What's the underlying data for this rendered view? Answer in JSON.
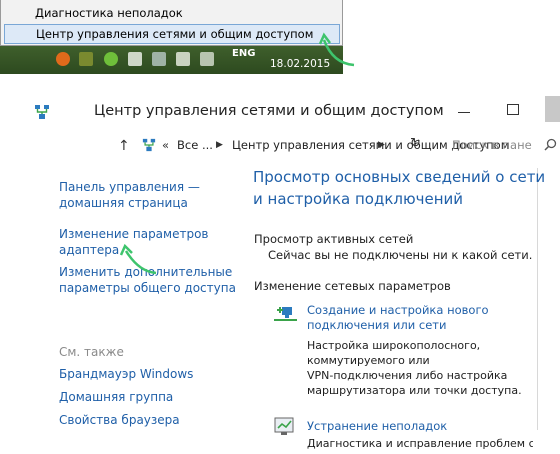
{
  "tray_menu": {
    "items": [
      "Диагностика неполадок",
      "Центр управления сетями и общим доступом"
    ]
  },
  "taskbar": {
    "lang": "ENG",
    "date": "18.02.2015"
  },
  "window": {
    "title": "Центр управления сетями и общим доступом"
  },
  "address_bar": {
    "prefix": "«",
    "crumbs": [
      "Все ...",
      "Центр управления сетями и общим доступом"
    ],
    "search_placeholder": "Поиск в пане"
  },
  "left_panel": {
    "links": [
      [
        "Панель управления —",
        "домашняя страница"
      ],
      [
        "Изменение параметров",
        "адаптера"
      ],
      [
        "Изменить дополнительные",
        "параметры общего доступа"
      ]
    ],
    "see_also_label": "См. также",
    "see_also": [
      "Брандмауэр Windows",
      "Домашняя группа",
      "Свойства браузера"
    ]
  },
  "main": {
    "title_lines": [
      "Просмотр основных сведений о сети",
      "и настройка подключений"
    ],
    "active_networks_label": "Просмотр активных сетей",
    "active_networks_value": "Сейчас вы не подключены ни к какой сети.",
    "change_settings_label": "Изменение сетевых параметров",
    "tasks": [
      {
        "title_lines": [
          "Создание и настройка нового",
          "подключения или сети"
        ],
        "desc_lines": [
          "Настройка широкополосного,",
          "коммутируемого или",
          "VPN-подключения либо настройка",
          "маршрутизатора или точки доступа."
        ]
      },
      {
        "title_lines": [
          "Устранение неполадок"
        ],
        "desc_lines": [
          "Диагностика и исправление проблем с"
        ]
      }
    ]
  },
  "colors": {
    "link": "#1f5fa8",
    "accent_arrow": "#3ec46d",
    "taskbar": "#35552a"
  }
}
